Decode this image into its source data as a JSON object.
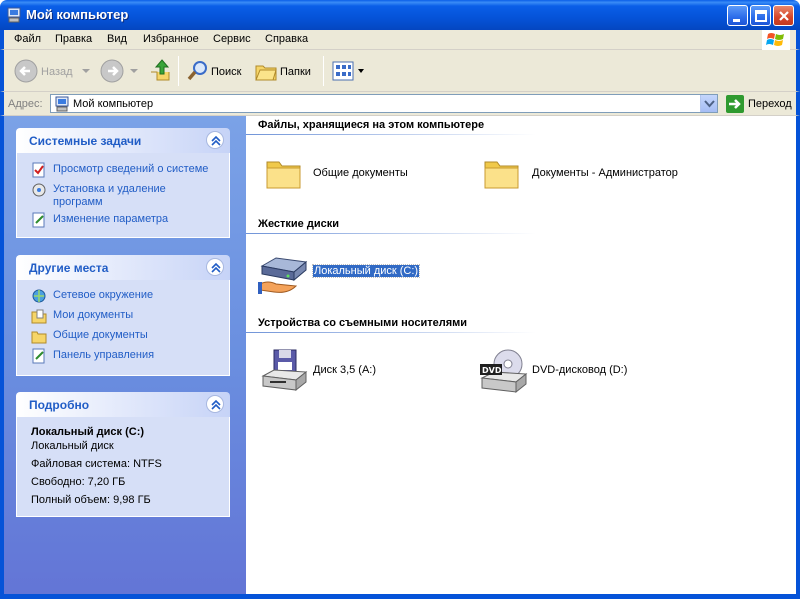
{
  "window": {
    "title": "Мой компьютер"
  },
  "menu": [
    "Файл",
    "Правка",
    "Вид",
    "Избранное",
    "Сервис",
    "Справка"
  ],
  "toolbar": {
    "back": "Назад",
    "search": "Поиск",
    "folders": "Папки"
  },
  "address": {
    "label": "Адрес:",
    "value": "Мой компьютер",
    "go": "Переход"
  },
  "tasks": {
    "title": "Системные задачи",
    "items": [
      "Просмотр сведений о системе",
      "Установка и удаление",
      "программ",
      "Изменение параметра"
    ]
  },
  "places": {
    "title": "Другие места",
    "items": [
      "Сетевое окружение",
      "Мои документы",
      "Общие документы",
      "Панель управления"
    ]
  },
  "details": {
    "title": "Подробно",
    "name": "Локальный диск (C:)",
    "type": "Локальный диск",
    "fs": "Файловая система: NTFS",
    "free": "Свободно: 7,20 ГБ",
    "total": "Полный объем: 9,98 ГБ"
  },
  "groups": {
    "files": {
      "title": "Файлы, хранящиеся на этом компьютере",
      "items": [
        "Общие документы",
        "Документы - Администратор"
      ]
    },
    "drives": {
      "title": "Жесткие диски",
      "items": [
        "Локальный диск (C:)"
      ]
    },
    "removable": {
      "title": "Устройства со съемными носителями",
      "items": [
        "Диск 3,5 (A:)",
        "DVD-дисковод (D:)"
      ]
    }
  },
  "colors": {
    "titlebar": "#0553d8",
    "link": "#215dc6",
    "selection": "#316ac5"
  }
}
